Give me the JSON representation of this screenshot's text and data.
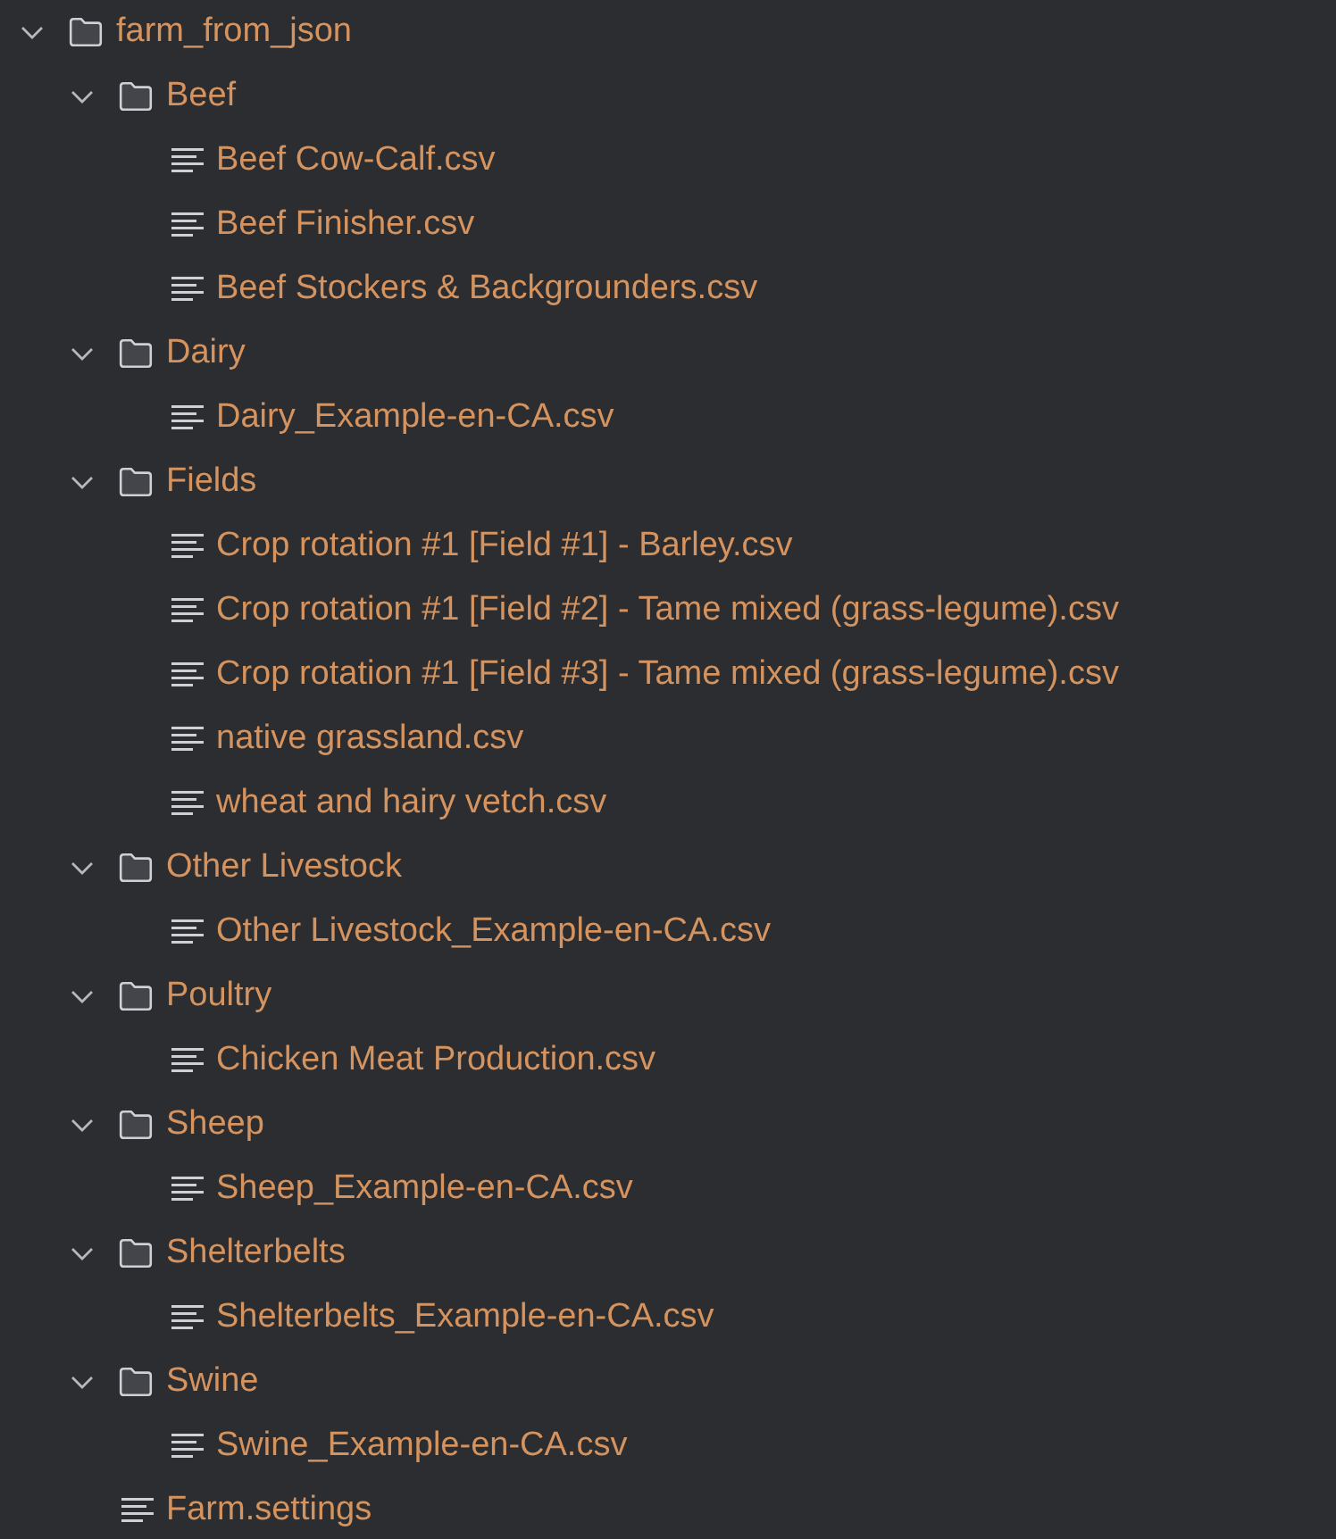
{
  "tree": {
    "name": "farm_from_json",
    "kind": "folder",
    "expanded": true,
    "children": [
      {
        "name": "Beef",
        "kind": "folder",
        "expanded": true,
        "children": [
          {
            "name": "Beef Cow-Calf.csv",
            "kind": "file"
          },
          {
            "name": "Beef Finisher.csv",
            "kind": "file"
          },
          {
            "name": "Beef Stockers & Backgrounders.csv",
            "kind": "file"
          }
        ]
      },
      {
        "name": "Dairy",
        "kind": "folder",
        "expanded": true,
        "children": [
          {
            "name": "Dairy_Example-en-CA.csv",
            "kind": "file"
          }
        ]
      },
      {
        "name": "Fields",
        "kind": "folder",
        "expanded": true,
        "children": [
          {
            "name": "Crop rotation #1 [Field #1] - Barley.csv",
            "kind": "file"
          },
          {
            "name": "Crop rotation #1 [Field #2] - Tame mixed (grass-legume).csv",
            "kind": "file"
          },
          {
            "name": "Crop rotation #1 [Field #3] - Tame mixed (grass-legume).csv",
            "kind": "file"
          },
          {
            "name": "native grassland.csv",
            "kind": "file"
          },
          {
            "name": "wheat and hairy vetch.csv",
            "kind": "file"
          }
        ]
      },
      {
        "name": "Other Livestock",
        "kind": "folder",
        "expanded": true,
        "children": [
          {
            "name": "Other Livestock_Example-en-CA.csv",
            "kind": "file"
          }
        ]
      },
      {
        "name": "Poultry",
        "kind": "folder",
        "expanded": true,
        "children": [
          {
            "name": "Chicken Meat Production.csv",
            "kind": "file"
          }
        ]
      },
      {
        "name": "Sheep",
        "kind": "folder",
        "expanded": true,
        "children": [
          {
            "name": "Sheep_Example-en-CA.csv",
            "kind": "file"
          }
        ]
      },
      {
        "name": "Shelterbelts",
        "kind": "folder",
        "expanded": true,
        "children": [
          {
            "name": "Shelterbelts_Example-en-CA.csv",
            "kind": "file"
          }
        ]
      },
      {
        "name": "Swine",
        "kind": "folder",
        "expanded": true,
        "children": [
          {
            "name": "Swine_Example-en-CA.csv",
            "kind": "file"
          }
        ]
      },
      {
        "name": "Farm.settings",
        "kind": "file"
      }
    ]
  }
}
